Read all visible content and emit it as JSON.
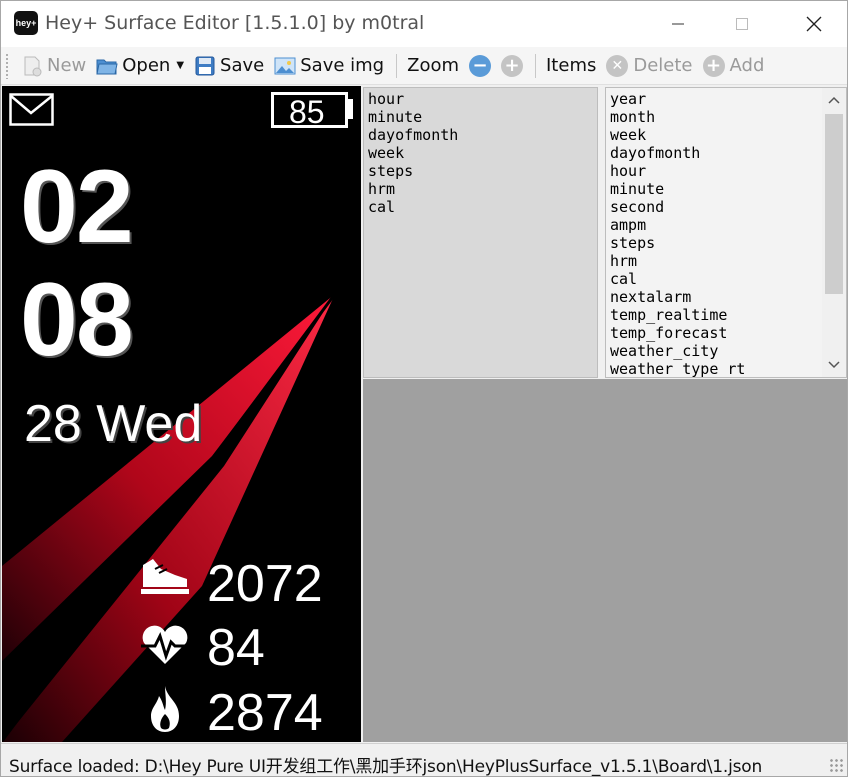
{
  "window": {
    "title": "Hey+ Surface Editor [1.5.1.0] by m0tral",
    "app_icon_text": "hey+"
  },
  "toolbar": {
    "new_label": "New",
    "open_label": "Open",
    "save_label": "Save",
    "save_img_label": "Save img",
    "zoom_label": "Zoom",
    "items_label": "Items",
    "delete_label": "Delete",
    "add_label": "Add"
  },
  "preview": {
    "battery": "85",
    "hour": "02",
    "minute": "08",
    "date": "28 Wed",
    "steps": "2072",
    "heart_rate": "84",
    "calories": "2874"
  },
  "used_items": [
    "hour",
    "minute",
    "dayofmonth",
    "week",
    "steps",
    "hrm",
    "cal"
  ],
  "available_items": [
    "year",
    "month",
    "week",
    "dayofmonth",
    "hour",
    "minute",
    "second",
    "ampm",
    "steps",
    "hrm",
    "cal",
    "nextalarm",
    "temp_realtime",
    "temp_forecast",
    "weather_city",
    "weather_type_rt"
  ],
  "status": {
    "text": "Surface loaded: D:\\Hey Pure UI开发组工作\\黑加手环json\\HeyPlusSurface_v1.5.1\\Board\\1.json"
  },
  "colors": {
    "accent_blue": "#5a9bd8",
    "disabled_gray": "#c4c4c4",
    "watchface_red": "#e0102a"
  }
}
